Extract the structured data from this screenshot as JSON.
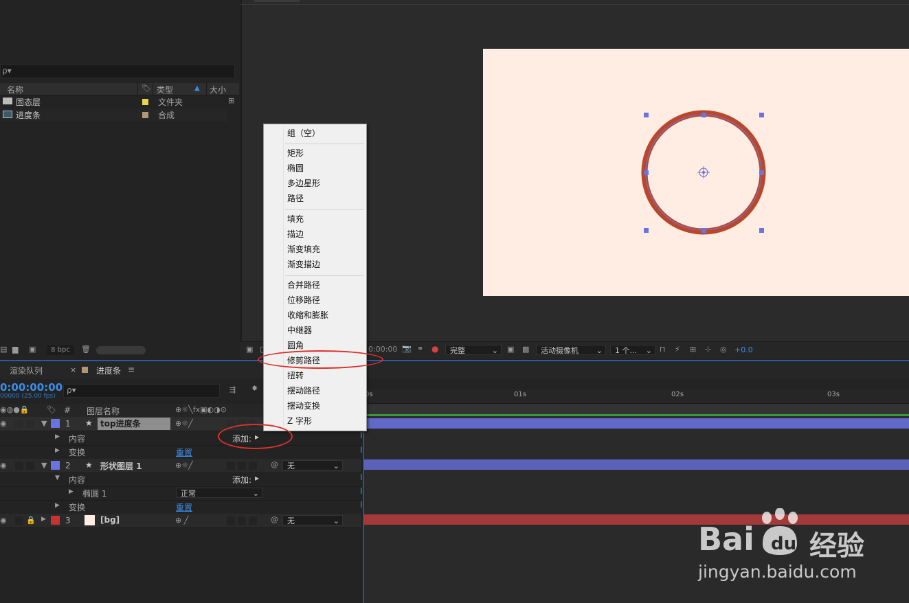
{
  "project": {
    "search_placeholder": "ρ▾",
    "col_name": "名称",
    "col_type": "类型",
    "col_size": "大小",
    "items": [
      {
        "name": "固态层",
        "type": "文件夹",
        "color": "#e8d44d"
      },
      {
        "name": "进度条",
        "type": "合成",
        "color": "#b19872"
      }
    ],
    "footer_bpc": "8 bpc"
  },
  "viewer": {
    "timecode": "0:00:00",
    "resolution": "完整",
    "camera": "活动摄像机",
    "views": "1 个...",
    "exposure": "+0.0",
    "canvas_color": "#ffede4",
    "ring_color": "#b9482a"
  },
  "timeline": {
    "tab_render": "渲染队列",
    "tab_comp": "进度条",
    "timecode": "0:00:00:00",
    "fps": "00000 (25.00 fps)",
    "search_placeholder": "ρ▾",
    "col_num": "#",
    "col_layer_name": "图层名称",
    "ruler": [
      "0s",
      "01s",
      "02s",
      "03s"
    ],
    "layers": [
      {
        "num": "1",
        "name": "top进度条",
        "label_color": "#6b73e0"
      },
      {
        "num": "2",
        "name": "形状图层 1",
        "label_color": "#6b73e0"
      },
      {
        "num": "3",
        "name": "[bg]",
        "label_color": "#c83232"
      }
    ],
    "contents": "内容",
    "transform": "变换",
    "add": "添加:",
    "reset": "重置",
    "ellipse": "椭圆 1",
    "blend_mode": "正常",
    "parent_none": "无"
  },
  "menu": {
    "items": [
      "组（空）",
      "矩形",
      "椭圆",
      "多边星形",
      "路径",
      "填充",
      "描边",
      "渐变填充",
      "渐变描边",
      "合并路径",
      "位移路径",
      "收缩和膨胀",
      "中继器",
      "圆角",
      "修剪路径",
      "扭转",
      "摆动路径",
      "摆动变换",
      "Z 字形"
    ]
  },
  "watermark": {
    "brand": "Bai",
    "brand_cn": "经验",
    "url": "jingyan.baidu.com"
  }
}
